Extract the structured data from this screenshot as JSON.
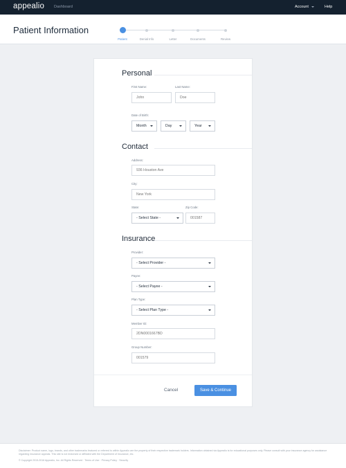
{
  "nav": {
    "brand": "appealio",
    "dashboard": "Dashboard",
    "account": "Account",
    "help": "Help"
  },
  "header": {
    "title": "Patient Information",
    "steps": [
      "Patient",
      "Denial Info",
      "Letter",
      "Documents",
      "Review"
    ],
    "active_step": 0
  },
  "form": {
    "personal": {
      "title": "Personal",
      "first_name_label": "First Name:",
      "first_name_placeholder": "John",
      "last_name_label": "Last Name:",
      "last_name_placeholder": "Doe",
      "dob_label": "Date of Birth:",
      "month": "Month",
      "day": "Day",
      "year": "Year"
    },
    "contact": {
      "title": "Contact",
      "address_label": "Address:",
      "address_placeholder": "936 Houston Ave",
      "city_label": "City:",
      "city_placeholder": "New York",
      "state_label": "State:",
      "state_value": "- Select State -",
      "zip_label": "Zip Code:",
      "zip_placeholder": "001587"
    },
    "insurance": {
      "title": "Insurance",
      "provider_label": "Provider:",
      "provider_value": "- Select Provider -",
      "payee_label": "Payee:",
      "payee_value": "- Select Payee -",
      "plan_type_label": "Plan Type:",
      "plan_type_value": "- Select Plan Type -",
      "member_id_label": "Member ID:",
      "member_id_placeholder": "2DN0001667BD",
      "group_number_label": "Group Number:",
      "group_number_placeholder": "001579"
    },
    "cancel_label": "Cancel",
    "save_label": "Save & Continue"
  },
  "footer": {
    "disclaimer": "Disclaimer: Product name, logo, brands, and other trademarks featured or referred to within Appealio are the property of their respective trademark holders. Information obtained via Appealio is for educational purposes only. Please consult with your insurance agency for assistance regarding insurance appeals. This site is not endorsed or affiliated with the Department of Insurance, etc.",
    "copyright": "© Copyright 2015-2016 Appealio, Inc. All Rights Reserved · Terms of Use · Privacy Policy · Security"
  },
  "colors": {
    "nav_bg": "#14212f",
    "accent": "#4a90e2",
    "page_bg": "#eef0f3"
  }
}
